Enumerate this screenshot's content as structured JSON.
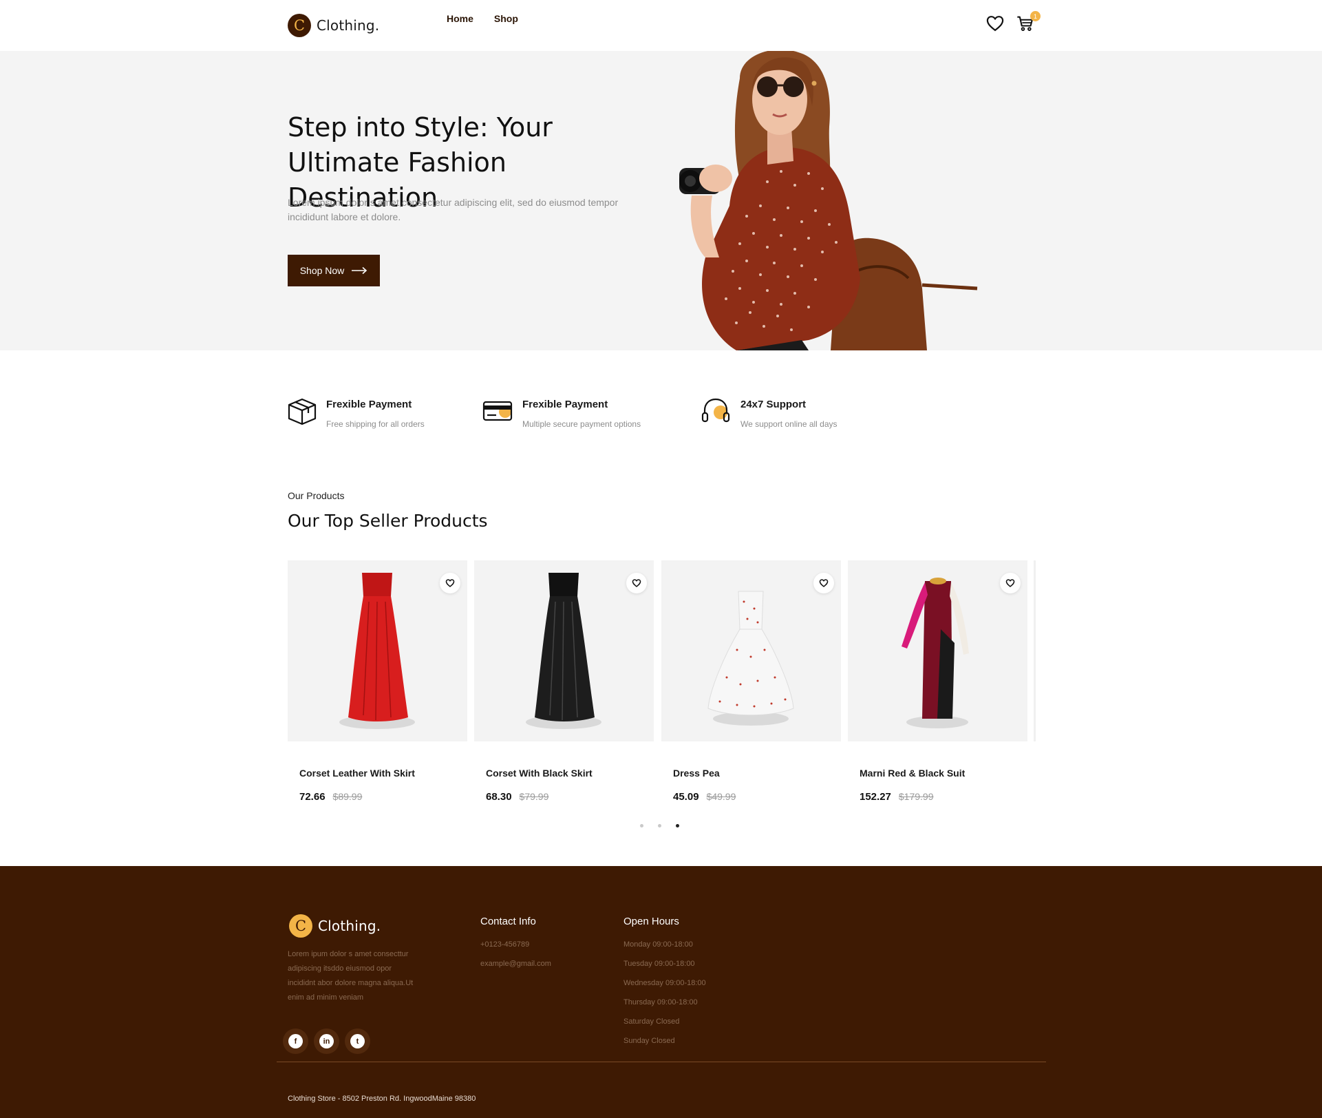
{
  "brand": {
    "logo_letter": "C",
    "name": "Clothing."
  },
  "nav": {
    "items": [
      "Home",
      "Shop"
    ]
  },
  "header": {
    "cart_count": "1"
  },
  "hero": {
    "title": "Step into Style: Your Ultimate Fashion Destination",
    "description": "Lorem ipsum dolor s amet,consectetur adipiscing elit, sed do eiusmod tempor incididunt labore et dolore.",
    "cta_label": "Shop Now"
  },
  "features": [
    {
      "icon": "box-icon",
      "title": "Frexible Payment",
      "subtitle": "Free shipping for all orders"
    },
    {
      "icon": "credit-card-icon",
      "title": "Frexible Payment",
      "subtitle": "Multiple secure payment options"
    },
    {
      "icon": "headset-icon",
      "title": "24x7 Support",
      "subtitle": "We support online all days"
    }
  ],
  "products_section": {
    "eyebrow": "Our Products",
    "title": "Our Top Seller Products",
    "items": [
      {
        "name": "Corset Leather With Skirt",
        "price": "72.66",
        "old_price": "$89.99",
        "color": "#d81e1e"
      },
      {
        "name": "Corset With Black Skirt",
        "price": "68.30",
        "old_price": "$79.99",
        "color": "#1a1a1a"
      },
      {
        "name": "Dress Pea",
        "price": "45.09",
        "old_price": "$49.99",
        "color": "#f7f7f7"
      },
      {
        "name": "Marni Red & Black Suit",
        "price": "152.27",
        "old_price": "$179.99",
        "color": "#7a1024"
      }
    ],
    "carousel": {
      "pages": 3,
      "active": 3
    }
  },
  "footer": {
    "about": "Lorem ipum dolor s amet consecttur adipiscing itsddo eiusmod opor incididnt abor dolore magna aliqua.Ut enim ad minim veniam",
    "socials": [
      {
        "icon": "facebook-icon",
        "glyph": "f"
      },
      {
        "icon": "linkedin-icon",
        "glyph": "in"
      },
      {
        "icon": "tumblr-icon",
        "glyph": "t"
      }
    ],
    "contact": {
      "title": "Contact Info",
      "items": [
        "+0123-456789",
        "example@gmail.com"
      ]
    },
    "hours": {
      "title": "Open Hours",
      "items": [
        "Monday 09:00-18:00",
        "Tuesday 09:00-18:00",
        "Wednesday 09:00-18:00",
        "Thursday 09:00-18:00",
        "Saturday Closed",
        "Sunday Closed"
      ]
    },
    "address": "Clothing Store - 8502 Preston Rd. IngwoodMaine 98380"
  },
  "colors": {
    "brand_brown": "#3e1a03",
    "accent_yellow": "#f3b447",
    "hero_bg": "#f4f4f4"
  }
}
